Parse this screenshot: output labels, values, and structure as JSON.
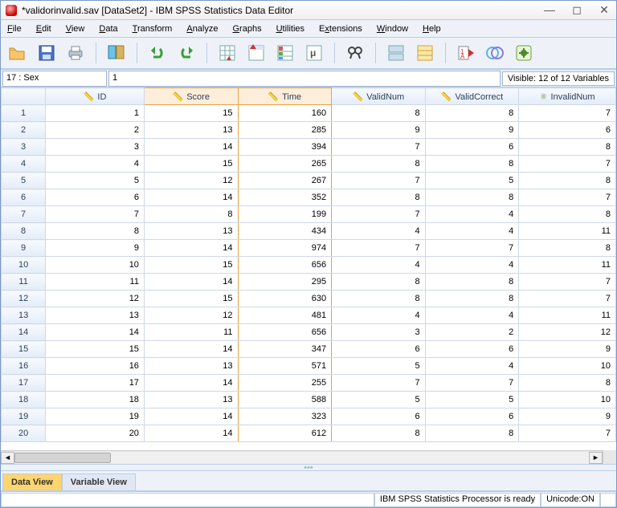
{
  "window": {
    "title": "*validorinvalid.sav [DataSet2] - IBM SPSS Statistics Data Editor"
  },
  "menu": {
    "file": "File",
    "edit": "Edit",
    "view": "View",
    "data": "Data",
    "transform": "Transform",
    "analyze": "Analyze",
    "graphs": "Graphs",
    "utilities": "Utilities",
    "extensions": "Extensions",
    "window": "Window",
    "help": "Help"
  },
  "infobar": {
    "cell_ref": "17 : Sex",
    "cell_val": "1",
    "visible": "Visible: 12 of 12 Variables"
  },
  "columns": {
    "rowhdr": "",
    "c0": "ID",
    "c1": "Score",
    "c2": "Time",
    "c3": "ValidNum",
    "c4": "ValidCorrect",
    "c5": "InvalidNum"
  },
  "chart_data": {
    "type": "table",
    "columns": [
      "ID",
      "Score",
      "Time",
      "ValidNum",
      "ValidCorrect",
      "InvalidNum"
    ],
    "rows": [
      [
        1,
        15,
        160,
        8,
        8,
        7
      ],
      [
        2,
        13,
        285,
        9,
        9,
        6
      ],
      [
        3,
        14,
        394,
        7,
        6,
        8
      ],
      [
        4,
        15,
        265,
        8,
        8,
        7
      ],
      [
        5,
        12,
        267,
        7,
        5,
        8
      ],
      [
        6,
        14,
        352,
        8,
        8,
        7
      ],
      [
        7,
        8,
        199,
        7,
        4,
        8
      ],
      [
        8,
        13,
        434,
        4,
        4,
        11
      ],
      [
        9,
        14,
        974,
        7,
        7,
        8
      ],
      [
        10,
        15,
        656,
        4,
        4,
        11
      ],
      [
        11,
        14,
        295,
        8,
        8,
        7
      ],
      [
        12,
        15,
        630,
        8,
        8,
        7
      ],
      [
        13,
        12,
        481,
        4,
        4,
        11
      ],
      [
        14,
        11,
        656,
        3,
        2,
        12
      ],
      [
        15,
        14,
        347,
        6,
        6,
        9
      ],
      [
        16,
        13,
        571,
        5,
        4,
        10
      ],
      [
        17,
        14,
        255,
        7,
        7,
        8
      ],
      [
        18,
        13,
        588,
        5,
        5,
        10
      ],
      [
        19,
        14,
        323,
        6,
        6,
        9
      ],
      [
        20,
        14,
        612,
        8,
        8,
        7
      ]
    ]
  },
  "tabs": {
    "data_view": "Data View",
    "variable_view": "Variable View"
  },
  "status": {
    "ready": "IBM SPSS Statistics Processor is ready",
    "unicode": "Unicode:ON"
  }
}
